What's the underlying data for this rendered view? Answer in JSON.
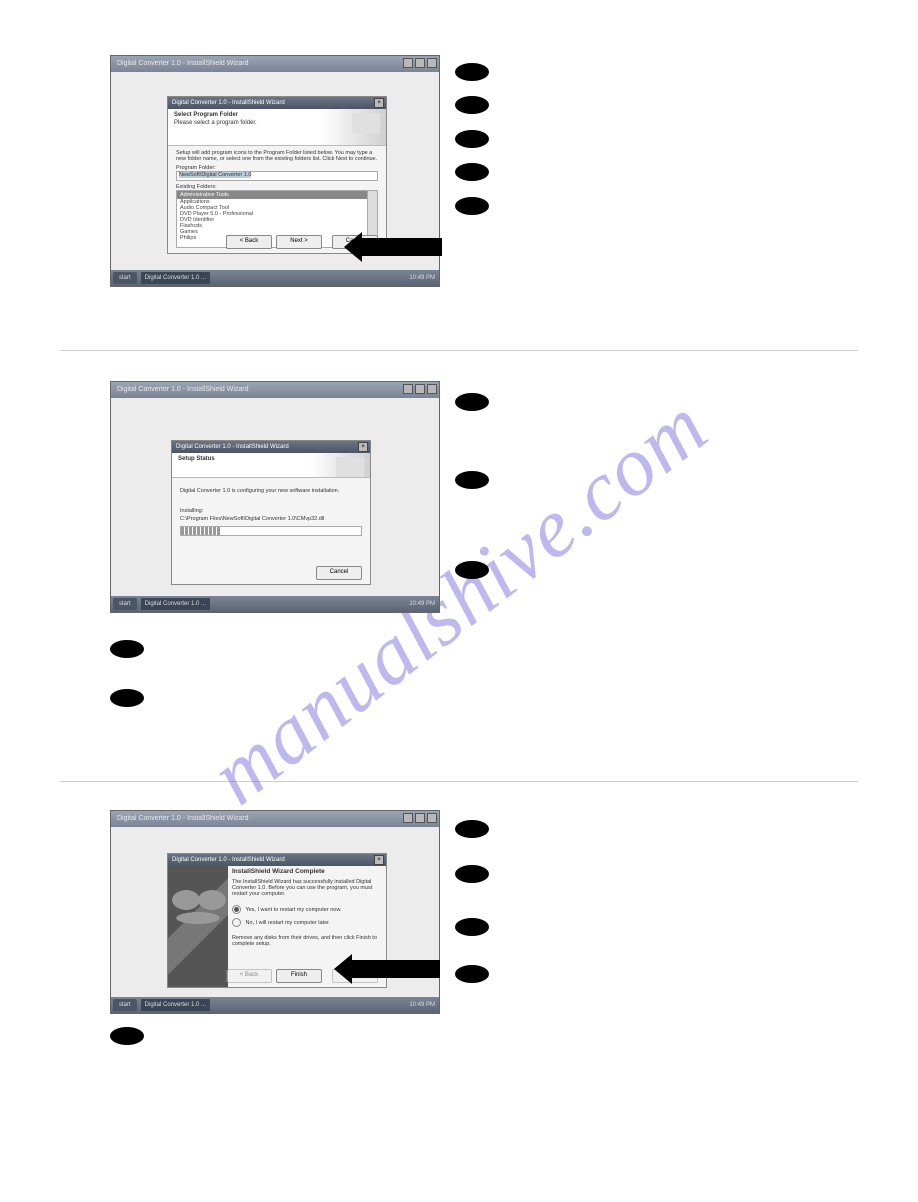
{
  "watermark": "manualshive.com",
  "common": {
    "outer_title": "Digital Converter 1.0 - InstallShield Wizard",
    "inner_title": "Digital Converter 1.0 - InstallShield Wizard",
    "start": "start",
    "task_item": "Digital Converter 1.0 ...",
    "clock1": "10:49 PM",
    "clock2": "10:49 PM",
    "clock3": "10:49 PM"
  },
  "screen1": {
    "banner_title": "Select Program Folder",
    "banner_sub": "Please select a program folder.",
    "instr": "Setup will add program icons to the Program Folder listed below. You may type a new folder name, or select one from the existing folders list. Click Next to continue.",
    "label_pf": "Program Folder:",
    "pf_value": "NewSoft\\Digital Converter 1.0",
    "label_ef": "Existing Folders:",
    "ef_items": [
      "Administrative Tools",
      "Applications",
      "Audio Compact Tool",
      "DVD Player 5.0 - Professional",
      "DVD Identifier",
      "Flashcds",
      "Games",
      "Philips"
    ],
    "btn_back": "< Back",
    "btn_next": "Next >",
    "btn_cancel": "Cancel"
  },
  "screen2": {
    "banner_title": "Setup Status",
    "body_line1": "Digital Converter 1.0 is configuring your new software installation.",
    "body_label_install": "Installing:",
    "body_path": "C:\\Program Files\\NewSoft\\Digital Converter 1.0\\CMvp32.dll",
    "btn_cancel": "Cancel"
  },
  "screen3": {
    "heading": "InstallShield Wizard Complete",
    "body_line": "The InstallShield Wizard has successfully installed Digital Converter 1.0. Before you can use the program, you must restart your computer.",
    "radio_yes": "Yes, I want to restart my computer now.",
    "radio_no": "No, I will restart my computer later.",
    "tail": "Remove any disks from their drives, and then click Finish to complete setup.",
    "btn_back": "< Back",
    "btn_finish": "Finish",
    "btn_cancel": "Cancel"
  }
}
